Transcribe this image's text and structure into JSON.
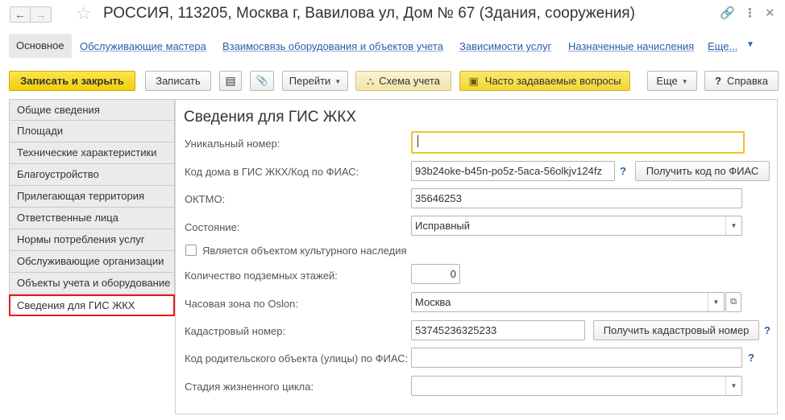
{
  "window": {
    "title": "РОССИЯ, 113205, Москва г, Вавилова ул, Дом № 67 (Здания, сооружения)",
    "back_icon": "←",
    "forward_icon": "→",
    "favorite_icon": "☆",
    "link_icon": "🔗",
    "menu_icon": "⋮",
    "close_icon": "✕"
  },
  "tabs": {
    "main": "Основное",
    "items": [
      "Обслуживающие мастера",
      "Взаимосвязь оборудования и объектов учета",
      "Зависимости услуг",
      "Назначенные начисления",
      "Еще..."
    ]
  },
  "toolbar": {
    "save_close": "Записать и закрыть",
    "save": "Записать",
    "list_icon": "▤",
    "attach_icon": "📎",
    "go": "Перейти",
    "scheme": "Схема учета",
    "scheme_icon": "⛬",
    "faq": "Часто задаваемые вопросы",
    "faq_icon": "▣",
    "more": "Еще",
    "help": "Справка",
    "help_icon": "?",
    "dropdown_arrow": "▼"
  },
  "sidebar": {
    "items": [
      "Общие сведения",
      "Площади",
      "Технические характеристики",
      "Благоустройство",
      "Прилегающая территория",
      "Ответственные лица",
      "Нормы потребления услуг",
      "Обслуживающие организации",
      "Объекты учета и оборудование",
      "Сведения для ГИС ЖКХ"
    ],
    "active_index": 9
  },
  "form": {
    "title": "Сведения для ГИС ЖКХ",
    "unique_number": {
      "label": "Уникальный номер:",
      "value": ""
    },
    "house_code": {
      "label": "Код дома в ГИС ЖКХ/Код по ФИАС:",
      "value": "93b24oke-b45n-po5z-5aca-56olkjv124fz",
      "button": "Получить код по ФИАС"
    },
    "oktmo": {
      "label": "ОКТМО:",
      "value": "35646253"
    },
    "state": {
      "label": "Состояние:",
      "value": "Исправный"
    },
    "cultural": {
      "label": "Является объектом культурного наследия",
      "checked": false
    },
    "underground_floors": {
      "label": "Количество подземных этажей:",
      "value": "0"
    },
    "timezone": {
      "label": "Часовая зона по Oslon:",
      "value": "Москва"
    },
    "cadastral": {
      "label": "Кадастровый номер:",
      "value": "53745236325233",
      "button": "Получить кадастровый номер"
    },
    "parent_code": {
      "label": "Код родительского объекта (улицы) по ФИАС:",
      "value": ""
    },
    "lifecycle": {
      "label": "Стадия жизненного цикла:",
      "value": ""
    },
    "help_mark": "?",
    "dropdown_arrow": "▼",
    "open_icon": "⧉"
  }
}
